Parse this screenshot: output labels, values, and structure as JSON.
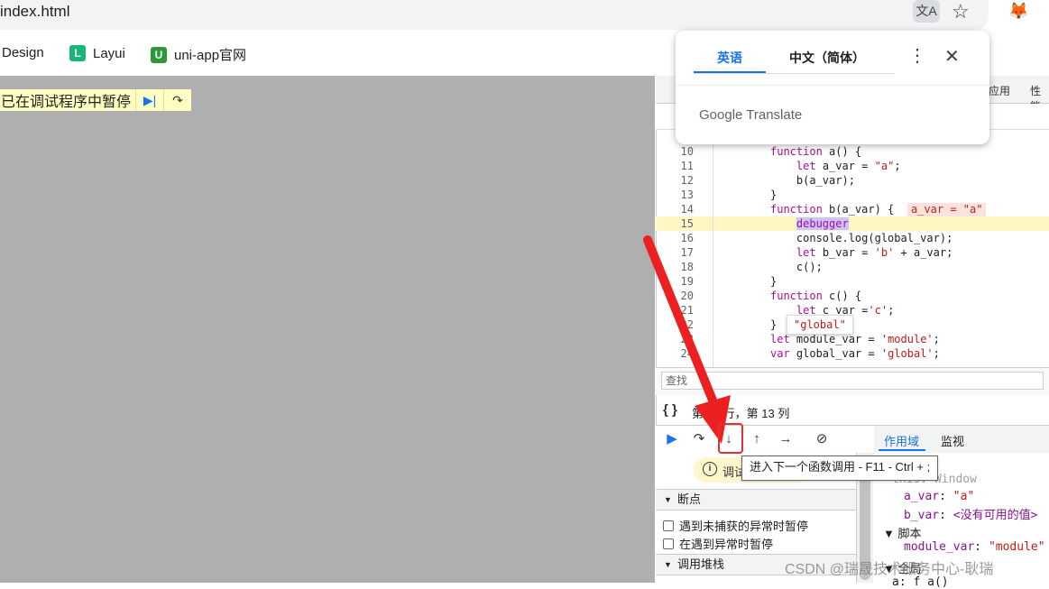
{
  "browser": {
    "url": "index.html",
    "bookmarks": [
      {
        "label": "Design"
      },
      {
        "label": "Layui",
        "icon": "layui-logo-icon",
        "color": "#16b777"
      },
      {
        "label": "uni-app官网",
        "icon": "uniapp-logo-icon",
        "color": "#2b9939"
      }
    ]
  },
  "paused_overlay": {
    "label": "已在调试程序中暂停",
    "resume_icon": "resume-icon",
    "step_over_icon": "step-over-icon"
  },
  "translate_popup": {
    "tab_source": "英语",
    "tab_target": "中文（简体）",
    "brand": "Google Translate"
  },
  "devtools": {
    "tabs_visible": [
      "应用",
      "性能"
    ],
    "code": {
      "lines": [
        {
          "n": "10",
          "text": "function a() {"
        },
        {
          "n": "11",
          "text": "    let a_var = \"a\";"
        },
        {
          "n": "12",
          "text": "    b(a_var);"
        },
        {
          "n": "13",
          "text": "}"
        },
        {
          "n": "14",
          "text": "function b(a_var) {"
        },
        {
          "n": "15",
          "text": "    debugger"
        },
        {
          "n": "16",
          "text": "    console.log(global_var);"
        },
        {
          "n": "17",
          "text": "    let b_var = 'b' + a_var;"
        },
        {
          "n": "18",
          "text": "    c();"
        },
        {
          "n": "19",
          "text": "}"
        },
        {
          "n": "20",
          "text": "function c() {"
        },
        {
          "n": "21",
          "text": "    let c_var ='c';"
        },
        {
          "n": "22",
          "text": "}"
        },
        {
          "n": "23",
          "text": "let module_var = 'module';"
        },
        {
          "n": "24",
          "text": "var global_var = 'global';"
        }
      ],
      "inline_value": "a_var = \"a\"",
      "hover_value": "\"global\""
    },
    "search_placeholder": "查找",
    "status": "第 15 行，第 13 列",
    "scope_tabs": {
      "scope": "作用域",
      "watch": "监视"
    },
    "paused_chip": "调试",
    "breakpoints_section": "断点",
    "checkbox_uncaught": "遇到未捕获的异常时暂停",
    "checkbox_caught": "在遇到异常时暂停",
    "callstack_section": "调用堆栈",
    "scope_vars": {
      "this_line": "this: Window",
      "a_var_name": "a_var",
      "a_var_value": "\"a\"",
      "b_var_name": "b_var",
      "b_var_value": "<没有可用的值>",
      "script_section": "脚本",
      "module_var_name": "module_var",
      "module_var_value": "\"module\"",
      "global_section": "全局",
      "a_func": "a: f a()"
    },
    "tooltip": "进入下一个函数调用 - F11 - Ctrl + ;"
  },
  "watermark": "CSDN @瑞晟技术服务中心-耿瑞"
}
